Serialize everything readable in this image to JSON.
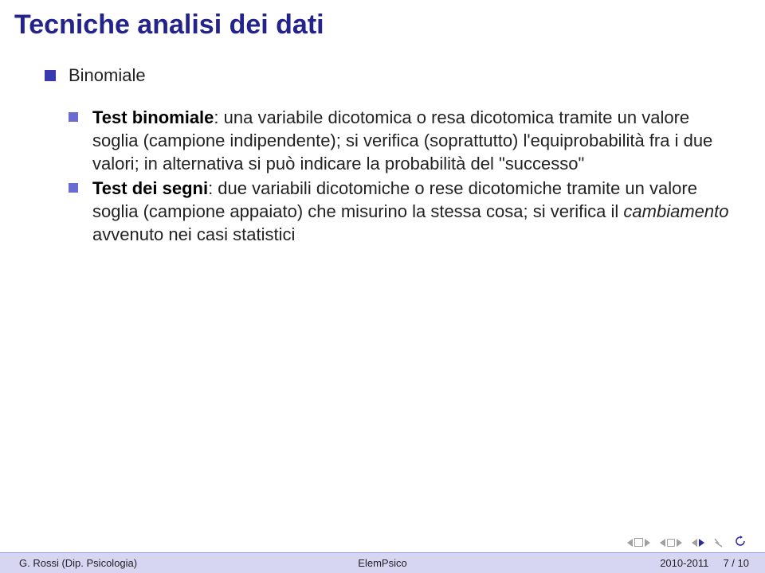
{
  "title": "Tecniche analisi dei dati",
  "main": {
    "item1": "Binomiale",
    "sub": {
      "s1_label": "Test binomiale",
      "s1_rest": ": una variabile dicotomica o resa dicotomica tramite un valore soglia (campione indipendente); si verifica (soprattutto) l'equiprobabilità fra i due valori; in alternativa si può indicare la probabilità del \"successo\"",
      "s2_label": "Test dei segni",
      "s2_rest_a": ": due variabili dicotomiche o rese dicotomiche tramite un valore soglia (campione appaiato) che misurino la stessa cosa; si verifica il ",
      "s2_rest_ital": "cambiamento",
      "s2_rest_b": " avvenuto nei casi statistici"
    }
  },
  "footer": {
    "left": "G. Rossi (Dip. Psicologia)",
    "center": "ElemPsico",
    "right": "2010-2011",
    "page": "7 / 10"
  }
}
